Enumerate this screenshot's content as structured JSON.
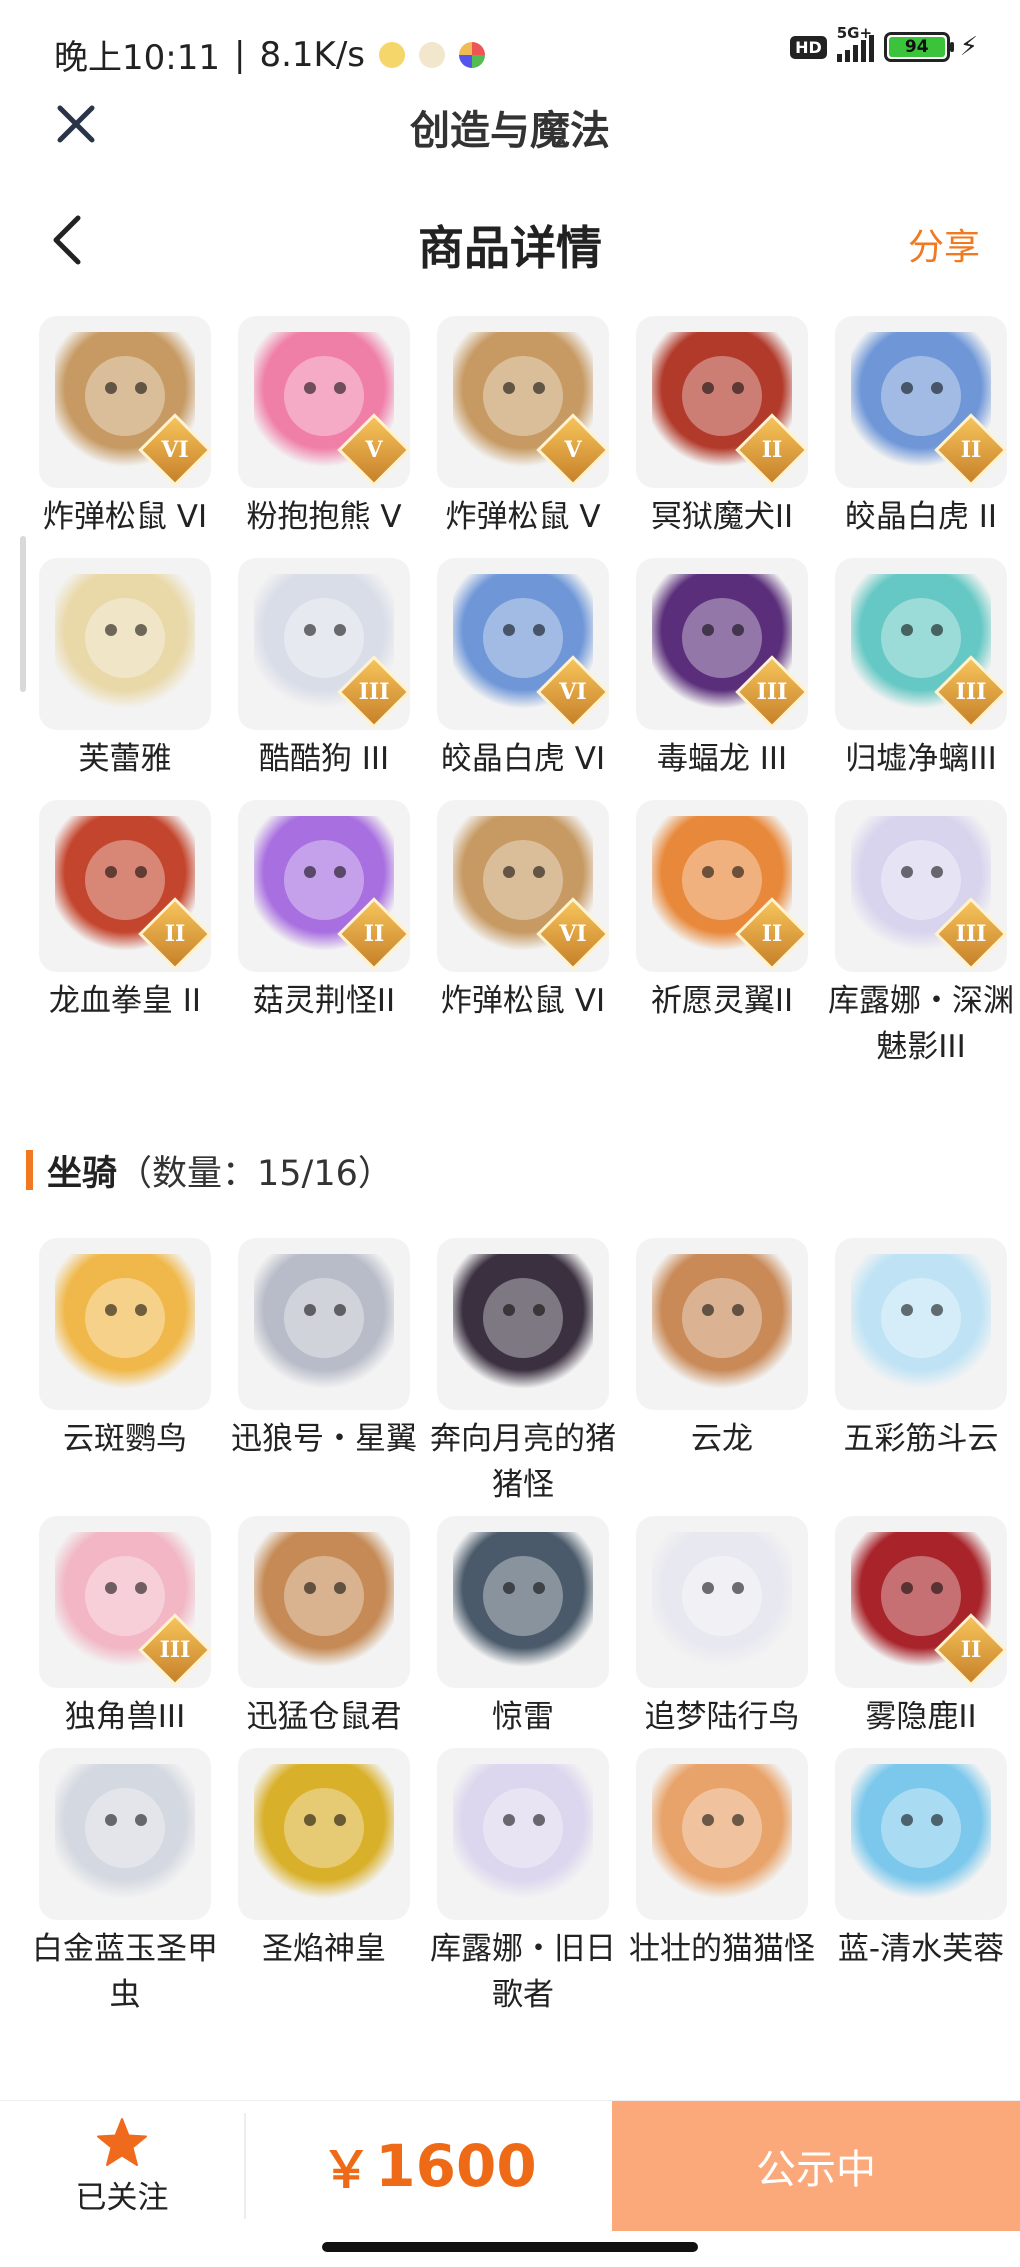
{
  "status_bar": {
    "time": "晚上10:11",
    "speed": "8.1K/s",
    "network": "5G+",
    "hd": "HD",
    "battery": "94"
  },
  "app_bar": {
    "title": "创造与魔法"
  },
  "nav": {
    "title": "商品详情",
    "share": "分享"
  },
  "pets": [
    {
      "name": "炸弹松鼠 VI",
      "tier": "VI",
      "color": "#c79a63"
    },
    {
      "name": "粉抱抱熊 V",
      "tier": "V",
      "color": "#f07fa8"
    },
    {
      "name": "炸弹松鼠 V",
      "tier": "V",
      "color": "#c79a63"
    },
    {
      "name": "冥狱魔犬II",
      "tier": "II",
      "color": "#b23a2a"
    },
    {
      "name": "皎晶白虎 II",
      "tier": "II",
      "color": "#6f97d8"
    },
    {
      "name": "芙蕾雅",
      "tier": "",
      "color": "#e9d8a8"
    },
    {
      "name": "酷酷狗 III",
      "tier": "III",
      "color": "#d9dde8"
    },
    {
      "name": "皎晶白虎 VI",
      "tier": "VI",
      "color": "#6f97d8"
    },
    {
      "name": "毒蝠龙 III",
      "tier": "III",
      "color": "#5a2e7a"
    },
    {
      "name": "归墟净螭III",
      "tier": "III",
      "color": "#66c8c4"
    },
    {
      "name": "龙血拳皇 II",
      "tier": "II",
      "color": "#c4452d"
    },
    {
      "name": "菇灵荆怪II",
      "tier": "II",
      "color": "#a86fe0"
    },
    {
      "name": "炸弹松鼠 VI",
      "tier": "VI",
      "color": "#c79a63"
    },
    {
      "name": "祈愿灵翼II",
      "tier": "II",
      "color": "#e8883a"
    },
    {
      "name": "库露娜・深渊魅影III",
      "tier": "III",
      "color": "#d8d4ee"
    }
  ],
  "mounts_section": {
    "title": "坐骑",
    "count": "（数量：15/16）"
  },
  "mounts": [
    {
      "name": "云斑鹦鸟",
      "tier": "",
      "color": "#f0b84a"
    },
    {
      "name": "迅狼号・星翼",
      "tier": "",
      "color": "#b8bcc8"
    },
    {
      "name": "奔向月亮的猪猪怪",
      "tier": "",
      "color": "#3a3040"
    },
    {
      "name": "云龙",
      "tier": "",
      "color": "#c98a58"
    },
    {
      "name": "五彩筋斗云",
      "tier": "",
      "color": "#bfe3f5"
    },
    {
      "name": "独角兽III",
      "tier": "III",
      "color": "#f2b6c4"
    },
    {
      "name": "迅猛仓鼠君",
      "tier": "",
      "color": "#c58a55"
    },
    {
      "name": "惊雷",
      "tier": "",
      "color": "#4a5a6a"
    },
    {
      "name": "追梦陆行鸟",
      "tier": "",
      "color": "#e8e8f0"
    },
    {
      "name": "雾隐鹿II",
      "tier": "II",
      "color": "#a8242a"
    },
    {
      "name": "白金蓝玉圣甲虫",
      "tier": "",
      "color": "#d4d8e0"
    },
    {
      "name": "圣焰神皇",
      "tier": "",
      "color": "#d9b02a"
    },
    {
      "name": "库露娜・旧日歌者",
      "tier": "",
      "color": "#dcd6ee"
    },
    {
      "name": "壮壮的猫猫怪",
      "tier": "",
      "color": "#e8a36a"
    },
    {
      "name": "蓝-清水芙蓉",
      "tier": "",
      "color": "#7cc8ec"
    }
  ],
  "bottom": {
    "follow": "已关注",
    "currency": "￥",
    "price": "1600",
    "status": "公示中"
  },
  "colors": {
    "accent": "#ef7a22",
    "price": "#ef6a16",
    "status_bg": "#fba97a"
  }
}
